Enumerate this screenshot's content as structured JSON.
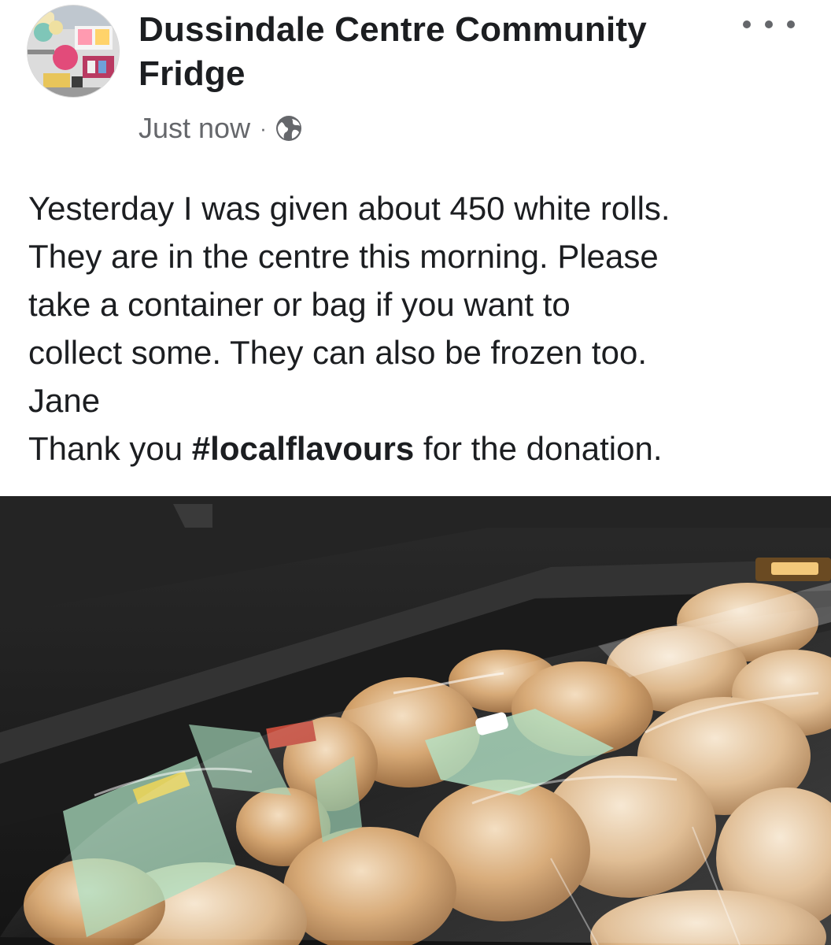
{
  "post": {
    "page_name": "Dussindale Centre Community Fridge",
    "timestamp": "Just now",
    "separator": "·",
    "privacy_icon": "globe-icon",
    "more_icon": "more-options-icon",
    "text_lines": [
      "Yesterday I was given about 450 white rolls.",
      "They are in the centre this morning. Please",
      "take a container or bag if you want to",
      "collect some. They can also be frozen too.",
      "Jane"
    ],
    "thanks_prefix": "Thank you ",
    "hashtag": "#localflavours",
    "thanks_suffix": " for the donation.",
    "photo_icon": "photo-bread-rolls"
  },
  "colors": {
    "text": "#1c1e21",
    "meta": "#65676b",
    "background": "#ffffff"
  }
}
